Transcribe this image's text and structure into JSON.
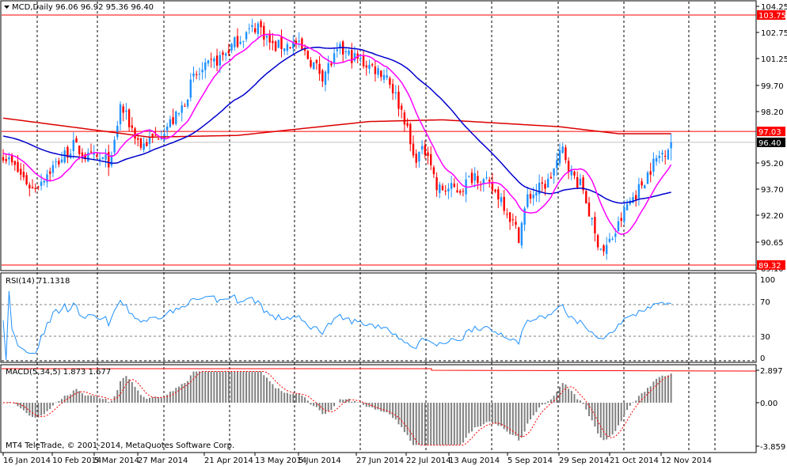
{
  "header": {
    "symbol": "MCD,Daily",
    "ohlc": "96.06 96.92 95.36 96.40"
  },
  "footer": {
    "copyright": "MT4 TeleTrade, © 2001-2014, MetaQuotes Software Corp."
  },
  "colors": {
    "up": "#1e90ff",
    "down": "#ff0000",
    "ma_fast": "#ff00ff",
    "ma_mid": "#0000cd",
    "ma_slow": "#dc0000",
    "rsi": "#1e90ff",
    "macd_hist": "#808080",
    "macd_signal": "#ff0000"
  },
  "chart_data": {
    "type": "candlestick",
    "title": "MCD,Daily",
    "last_ohlc": {
      "open": 96.06,
      "high": 96.92,
      "low": 95.36,
      "close": 96.4
    },
    "price_axis": {
      "ticks": [
        "104.25",
        "102.75",
        "101.25",
        "99.70",
        "98.20",
        "95.20",
        "93.70",
        "92.20",
        "90.65",
        "89.10"
      ],
      "ylim": [
        89.1,
        104.25
      ]
    },
    "levels": [
      {
        "label": "103.75",
        "value": 103.75,
        "kind": "resistance"
      },
      {
        "label": "97.03",
        "value": 97.03,
        "kind": "resistance"
      },
      {
        "label": "96.40",
        "value": 96.4,
        "kind": "current"
      },
      {
        "label": "89.32",
        "value": 89.32,
        "kind": "support"
      }
    ],
    "close_anchors": [
      [
        0,
        95.75
      ],
      [
        10,
        93.7
      ],
      [
        16,
        94.8
      ],
      [
        24,
        96.2
      ],
      [
        29,
        95.5
      ],
      [
        37,
        95.3
      ],
      [
        40,
        98.5
      ],
      [
        47,
        96.2
      ],
      [
        52,
        96.7
      ],
      [
        60,
        98.0
      ],
      [
        65,
        100.1
      ],
      [
        75,
        101.4
      ],
      [
        80,
        102.3
      ],
      [
        87,
        103.2
      ],
      [
        92,
        101.9
      ],
      [
        100,
        102.1
      ],
      [
        109,
        100.3
      ],
      [
        115,
        101.7
      ],
      [
        123,
        101.0
      ],
      [
        131,
        100.3
      ],
      [
        137,
        97.8
      ],
      [
        140,
        95.5
      ],
      [
        145,
        96.0
      ],
      [
        148,
        93.7
      ],
      [
        156,
        93.7
      ],
      [
        161,
        94.6
      ],
      [
        170,
        93.2
      ],
      [
        176,
        91.0
      ],
      [
        179,
        93.2
      ],
      [
        186,
        94.1
      ],
      [
        191,
        96.0
      ],
      [
        194,
        94.6
      ],
      [
        198,
        93.7
      ],
      [
        202,
        91.0
      ],
      [
        205,
        90.1
      ],
      [
        209,
        91.2
      ],
      [
        213,
        92.8
      ],
      [
        217,
        93.7
      ],
      [
        222,
        95.2
      ],
      [
        228,
        96.4
      ]
    ],
    "ma_slow_anchors": [
      [
        0,
        97.8
      ],
      [
        50,
        96.7
      ],
      [
        80,
        96.8
      ],
      [
        108,
        97.3
      ],
      [
        125,
        97.6
      ],
      [
        150,
        97.7
      ],
      [
        190,
        97.3
      ],
      [
        210,
        96.9
      ],
      [
        228,
        96.9
      ]
    ],
    "x_labels": [
      "16 Jan 2014",
      "10 Feb 2014",
      "5 Mar 2014",
      "27 Mar 2014",
      "21 Apr 2014",
      "13 May 2014",
      "5 Jun 2014",
      "27 Jun 2014",
      "22 Jul 2014",
      "13 Aug 2014",
      "5 Sep 2014",
      "29 Sep 2014",
      "21 Oct 2014",
      "12 Nov 2014"
    ],
    "rsi": {
      "label": "RSI(14) 71.1318",
      "ticks": [
        "100",
        "70",
        "30",
        "0"
      ],
      "levels": [
        70,
        30
      ],
      "ylim": [
        0,
        100
      ]
    },
    "macd": {
      "label": "MACD(5,34,5) 1.873 1.677",
      "ticks": [
        "2.897",
        "0.00",
        "-3.859"
      ],
      "ylim": [
        -3.859,
        2.897
      ]
    }
  }
}
